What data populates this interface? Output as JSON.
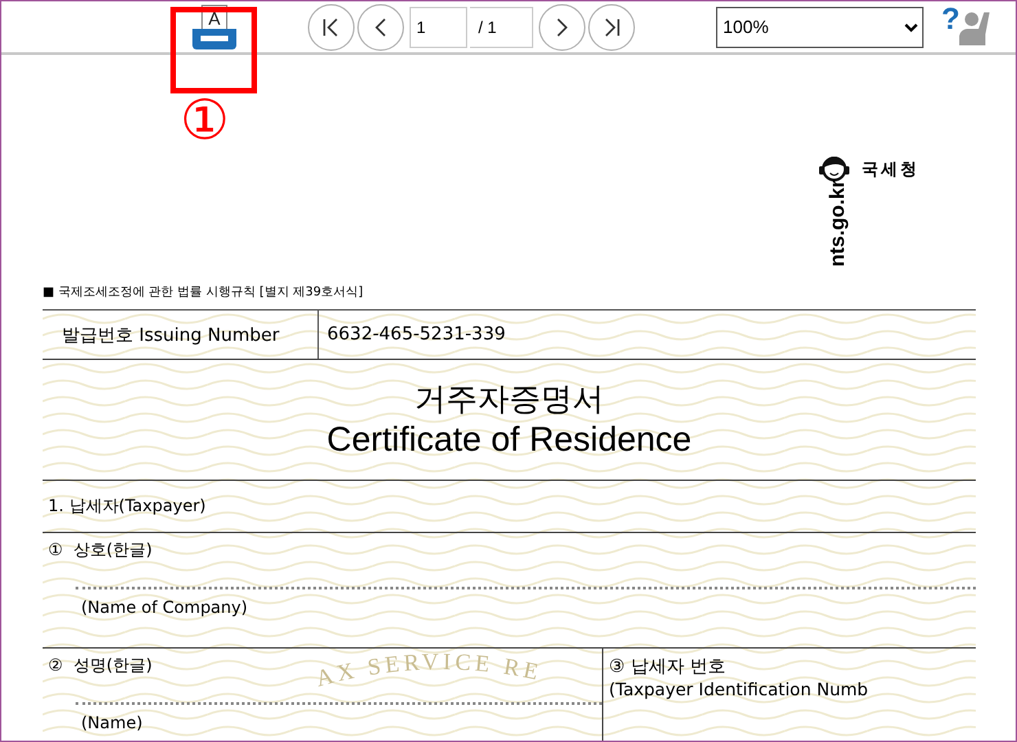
{
  "toolbar": {
    "print_icon_letter": "A",
    "page_value": "1",
    "page_total": "/ 1",
    "zoom": "100%",
    "help_mark": "?"
  },
  "annotation": {
    "label": "①"
  },
  "agency": {
    "name": "국세청",
    "site": "nts.go.kr"
  },
  "form_reference": "■ 국제조세조정에 관한 법률 시행규칙 [별지 제39호서식]",
  "issuing": {
    "label": "발급번호 Issuing Number",
    "value": "6632-465-5231-339"
  },
  "title": {
    "korean": "거주자증명서",
    "english": "Certificate of Residence"
  },
  "seal_text": "AX SERVICE RE",
  "section": "1. 납세자(Taxpayer)",
  "fields": [
    {
      "number": "①",
      "label": "상호(한글)",
      "english": "(Name of Company)"
    },
    {
      "number": "②",
      "label": "성명(한글)",
      "english": "(Name)"
    }
  ],
  "side_field": {
    "number": "③",
    "label": "납세자 번호",
    "english": "(Taxpayer Identification Numb"
  }
}
